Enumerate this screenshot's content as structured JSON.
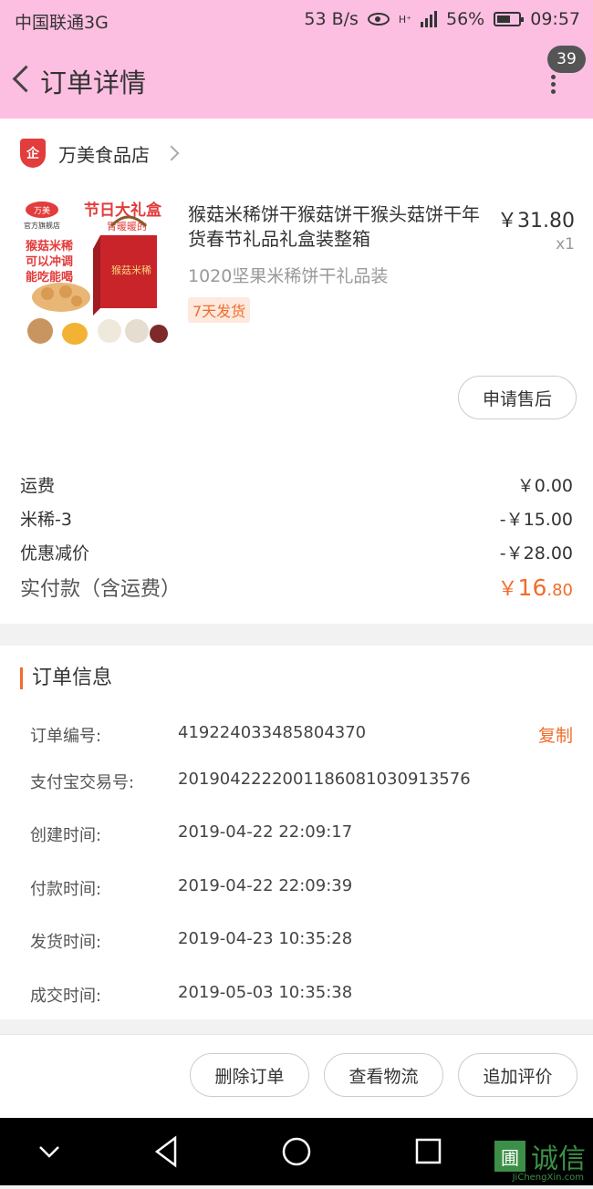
{
  "status": {
    "carrier": "中国联通3G",
    "speed": "53 B/s",
    "network": "H⁺",
    "battery": "56%",
    "time": "09:57"
  },
  "nav": {
    "title": "订单详情",
    "badge": "39",
    "icons": {
      "back": "back-arrow-icon",
      "more": "more-icon"
    }
  },
  "shop": {
    "icon_text": "企",
    "name": "万美食品店"
  },
  "product": {
    "image": {
      "logo": "万美",
      "shop_label": "官方旗舰店",
      "headline": "节日大礼盒",
      "sub": "胃暖暖的",
      "side_lines": [
        "猴菇米稀",
        "可以冲调",
        "能吃能喝"
      ],
      "box_text": "猴菇米稀"
    },
    "title": "猴菇米稀饼干猴菇饼干猴头菇饼干年货春节礼品礼盒装整箱",
    "price": "￥31.80",
    "qty": "x1",
    "spec": "1020坚果米稀饼干礼品装",
    "tag": "7天发货"
  },
  "after_sale_btn": "申请售后",
  "summary": [
    {
      "label": "运费",
      "value": "￥0.00"
    },
    {
      "label": "米稀-3",
      "value": "-￥15.00"
    },
    {
      "label": "优惠减价",
      "value": "-￥28.00"
    }
  ],
  "total": {
    "label": "实付款（含运费）",
    "currency": "￥",
    "int": "16",
    "dec": ".80"
  },
  "order_info": {
    "title": "订单信息",
    "copy_label": "复制",
    "rows": [
      {
        "label": "订单编号:",
        "value": "419224033485804370"
      },
      {
        "label": "支付宝交易号:",
        "value": "2019042222001186081030913576"
      },
      {
        "label": "创建时间:",
        "value": "2019-04-22 22:09:17"
      },
      {
        "label": "付款时间:",
        "value": "2019-04-22 22:09:39"
      },
      {
        "label": "发货时间:",
        "value": "2019-04-23 10:35:28"
      },
      {
        "label": "成交时间:",
        "value": "2019-05-03 10:35:38"
      }
    ]
  },
  "actions": {
    "delete": "删除订单",
    "logistics": "查看物流",
    "review": "追加评价"
  },
  "watermark": {
    "icon": "圃",
    "text": "诚信",
    "sub": "JiChengXin.com"
  }
}
